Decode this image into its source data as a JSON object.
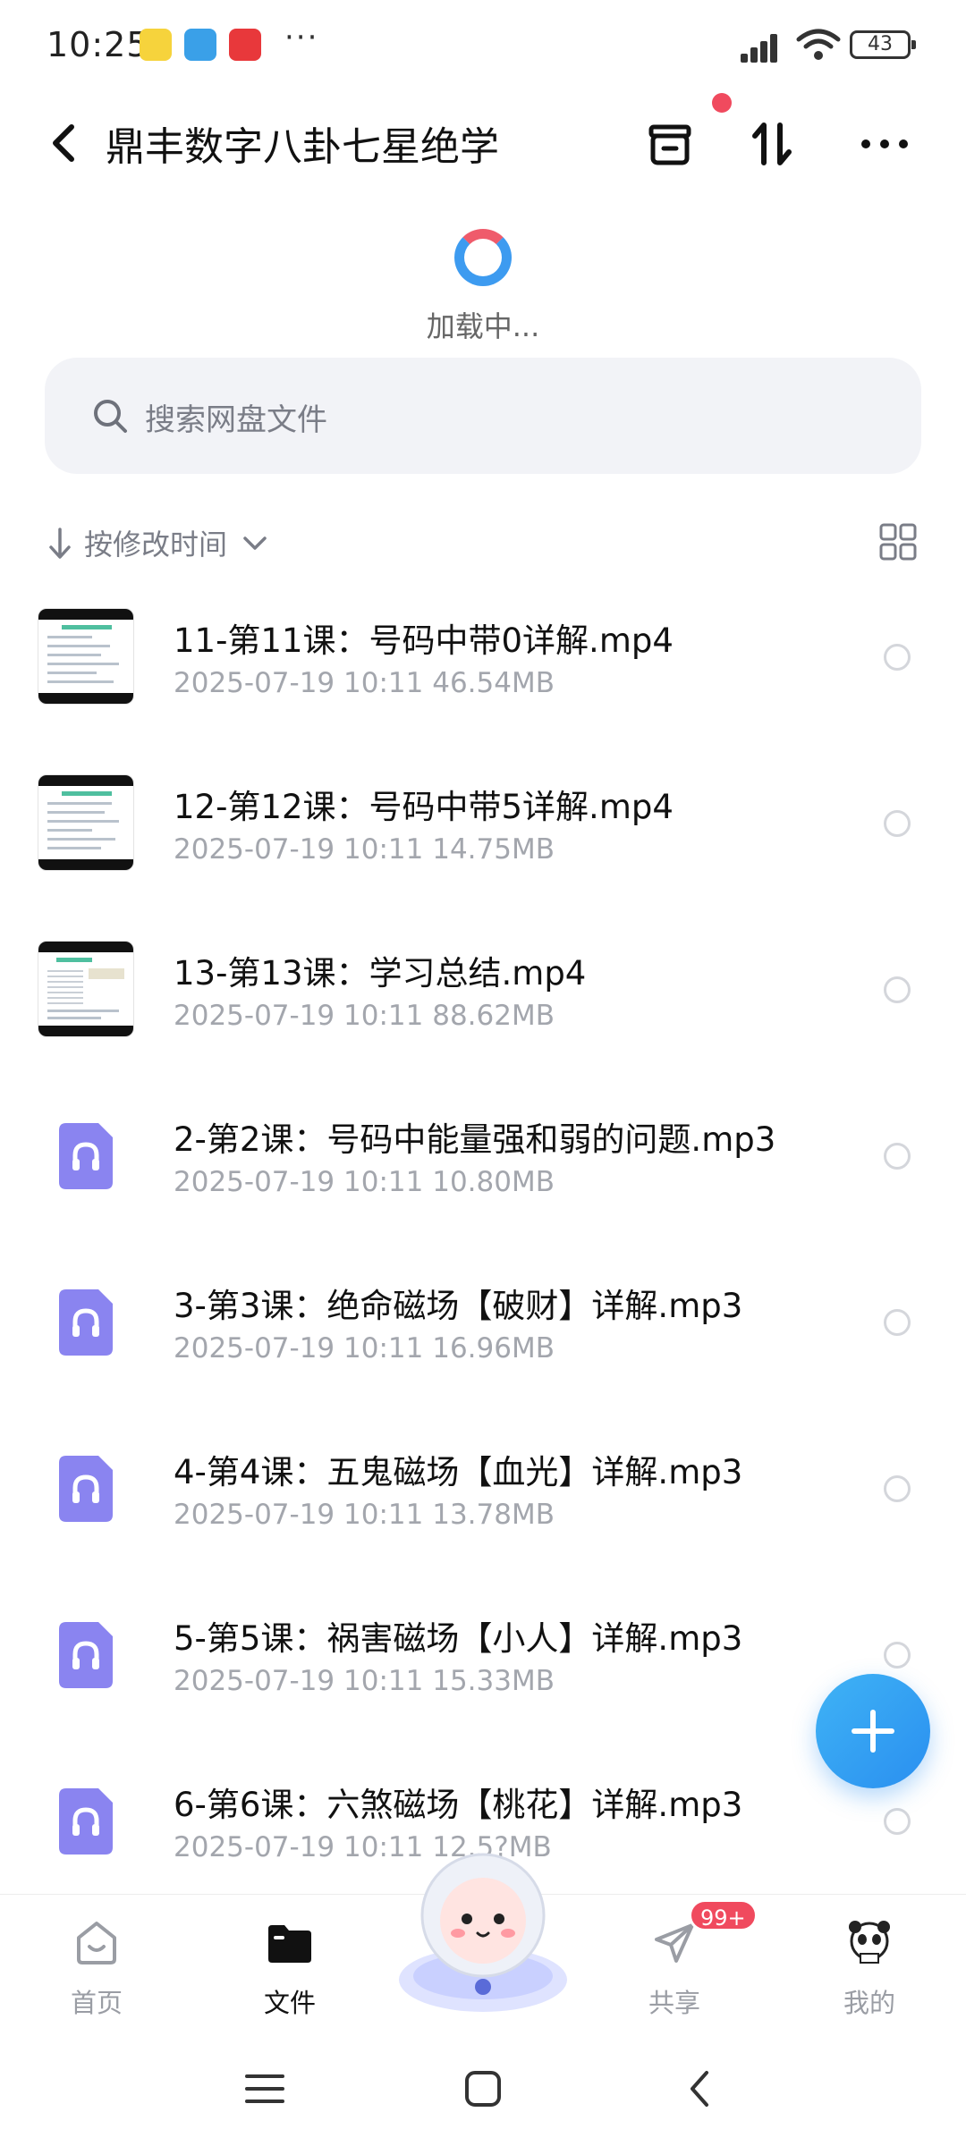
{
  "status_bar": {
    "time": "10:25",
    "dots": "···",
    "battery": "43",
    "app_icon_colors": [
      "#f6d33c",
      "#3aa0e8",
      "#e8383b"
    ]
  },
  "header": {
    "title": "鼎丰数字八卦七星绝学",
    "icons": [
      "back-icon",
      "archive-icon",
      "sort-swap-icon",
      "more-icon"
    ],
    "notify_color": "#f04a5e"
  },
  "loading": {
    "text": "加载中..."
  },
  "search": {
    "placeholder": "搜索网盘文件"
  },
  "sort": {
    "label": "按修改时间"
  },
  "files": [
    {
      "name": "11-第11课：号码中带0详解.mp4",
      "date": "2025-07-19",
      "time": "10:11",
      "size": "46.54MB",
      "type": "video"
    },
    {
      "name": "12-第12课：号码中带5详解.mp4",
      "date": "2025-07-19",
      "time": "10:11",
      "size": "14.75MB",
      "type": "video"
    },
    {
      "name": "13-第13课：学习总结.mp4",
      "date": "2025-07-19",
      "time": "10:11",
      "size": "88.62MB",
      "type": "video"
    },
    {
      "name": "2-第2课：号码中能量强和弱的问题.mp3",
      "date": "2025-07-19",
      "time": "10:11",
      "size": "10.80MB",
      "type": "audio"
    },
    {
      "name": "3-第3课：绝命磁场【破财】详解.mp3",
      "date": "2025-07-19",
      "time": "10:11",
      "size": "16.96MB",
      "type": "audio"
    },
    {
      "name": "4-第4课：五鬼磁场【血光】详解.mp3",
      "date": "2025-07-19",
      "time": "10:11",
      "size": "13.78MB",
      "type": "audio"
    },
    {
      "name": "5-第5课：祸害磁场【小人】详解.mp3",
      "date": "2025-07-19",
      "time": "10:11",
      "size": "15.33MB",
      "type": "audio"
    },
    {
      "name": "6-第6课：六煞磁场【桃花】详解.mp3",
      "date": "2025-07-19",
      "time": "10:11",
      "size": "12.5?MB",
      "type": "audio"
    }
  ],
  "bottom_nav": {
    "items": [
      {
        "label": "首页",
        "icon": "home-icon"
      },
      {
        "label": "文件",
        "icon": "folder-icon",
        "active": true
      },
      {
        "label": "共享",
        "icon": "send-icon"
      },
      {
        "label": "我的",
        "icon": "profile-avatar-icon"
      }
    ],
    "share_badge": "99+",
    "accent": "#2a8ff0"
  }
}
